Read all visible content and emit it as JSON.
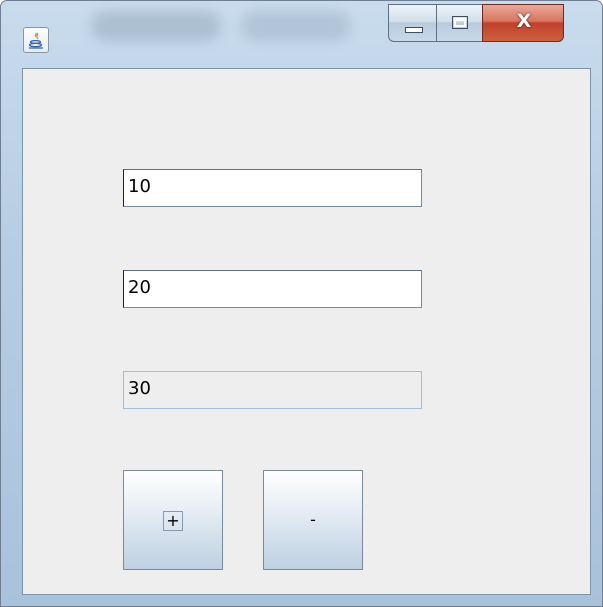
{
  "window": {
    "icon": "java-icon",
    "controls": {
      "minimize_icon": "minimize-icon",
      "maximize_icon": "maximize-icon",
      "close_label": "X"
    }
  },
  "form": {
    "first_operand": "10",
    "second_operand": "20",
    "result": "30"
  },
  "buttons": {
    "add_label": "+",
    "subtract_label": "-"
  },
  "colors": {
    "client_bg": "#eeeeee",
    "close_button": "#c9533c",
    "result_border": "#a7bfd6"
  }
}
